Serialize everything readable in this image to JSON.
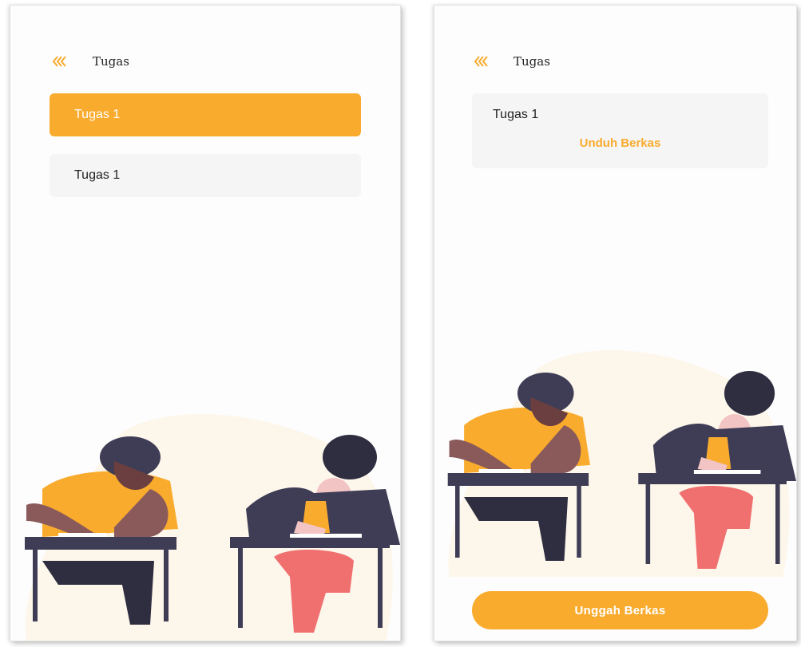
{
  "colors": {
    "accent": "#f9ab2d",
    "card_bg": "#f5f5f5",
    "text": "#222222"
  },
  "list_screen": {
    "header": {
      "title": "Tugas",
      "back_icon": "double-chevron-left-icon"
    },
    "items": [
      {
        "label": "Tugas 1",
        "state": "selected"
      },
      {
        "label": "Tugas 1",
        "state": "default"
      }
    ]
  },
  "detail_screen": {
    "header": {
      "title": "Tugas",
      "back_icon": "double-chevron-left-icon"
    },
    "task": {
      "title": "Tugas 1",
      "download_label": "Unduh Berkas"
    },
    "upload_label": "Unggah Berkas"
  }
}
